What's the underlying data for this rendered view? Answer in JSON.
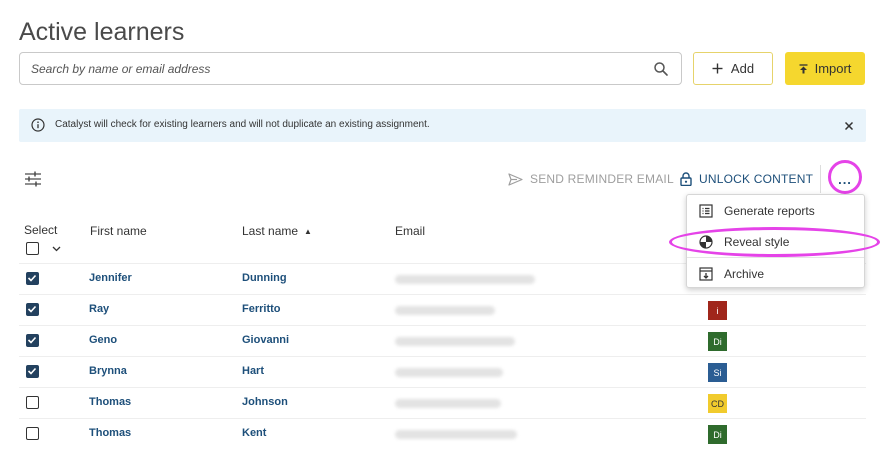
{
  "page": {
    "title": "Active learners"
  },
  "search": {
    "placeholder": "Search by name or email address"
  },
  "actions": {
    "add_label": "Add",
    "import_label": "Import"
  },
  "banner": {
    "text": "Catalyst will check for existing learners and will not duplicate an existing assignment."
  },
  "toolbar": {
    "send_reminder_label": "SEND REMINDER EMAIL",
    "unlock_label": "UNLOCK CONTENT",
    "more_label": "..."
  },
  "table": {
    "headers": {
      "select": "Select",
      "first_name": "First name",
      "last_name": "Last name",
      "email": "Email"
    },
    "sort": {
      "column": "Last name",
      "direction": "ascending"
    },
    "rows": [
      {
        "first": "Jennifer",
        "last": "Dunning",
        "checked": true,
        "style": "",
        "style_color": ""
      },
      {
        "first": "Ray",
        "last": "Ferritto",
        "checked": true,
        "style": "i",
        "style_color": "#a0261b"
      },
      {
        "first": "Geno",
        "last": "Giovanni",
        "checked": true,
        "style": "Di",
        "style_color": "#2f6b2d"
      },
      {
        "first": "Brynna",
        "last": "Hart",
        "checked": true,
        "style": "Si",
        "style_color": "#2b5d93"
      },
      {
        "first": "Thomas",
        "last": "Johnson",
        "checked": false,
        "style": "CD",
        "style_color": "#f1cb2d"
      },
      {
        "first": "Thomas",
        "last": "Kent",
        "checked": false,
        "style": "Di",
        "style_color": "#2f6b2d"
      }
    ]
  },
  "menu": {
    "items": [
      "Generate reports",
      "Reveal style",
      "Archive"
    ]
  },
  "colors": {
    "accent_yellow": "#f5d72e",
    "link_blue": "#1d4f7a",
    "highlight_magenta": "#e543e8",
    "banner_bg": "#e9f4fb"
  }
}
